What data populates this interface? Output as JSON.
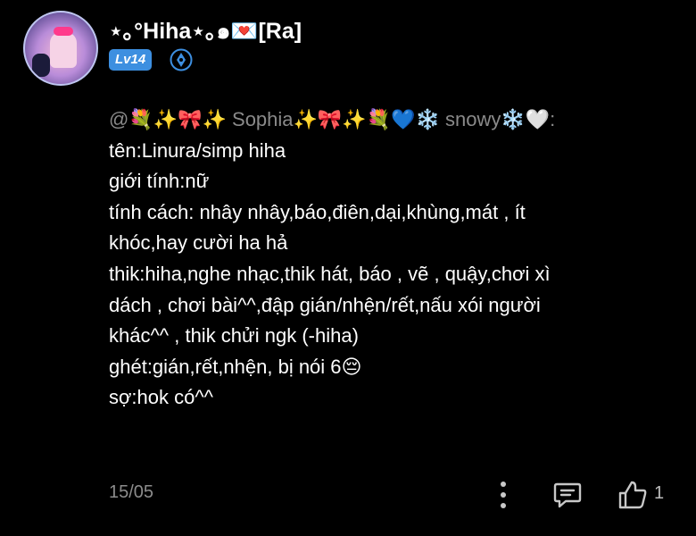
{
  "user": {
    "name": "⋆｡°Hiha⋆｡๑💌[Ra]",
    "level": "Lv14"
  },
  "comment": {
    "mention": "@💐✨🎀✨ Sophia✨🎀✨💐💙❄️ snowy❄️🤍:",
    "lines": [
      "tên:Linura/simp hiha",
      "giới tính:nữ",
      "tính cách: nhây nhây,báo,điên,dại,khùng,mát , ít",
      "khóc,hay cười ha hả",
      "thik:hiha,nghe nhạc,thik hát, báo , vẽ , quậy,chơi xì",
      "dách , chơi bài^^,đập gián/nhện/rết,nấu xói người",
      "khác^^ , thik chửi ngk (-hiha)",
      "ghét:gián,rết,nhện, bị nói 6😔",
      "sợ:hok có^^"
    ]
  },
  "footer": {
    "date": "15/05",
    "like_count": "1"
  },
  "icons": {
    "more": "more-vertical-icon",
    "comment": "comment-icon",
    "like": "thumbs-up-icon",
    "badge": "verified-badge-icon"
  },
  "colors": {
    "background": "#000000",
    "level_badge": "#3d8fe0",
    "muted_text": "#8c8c8c"
  }
}
